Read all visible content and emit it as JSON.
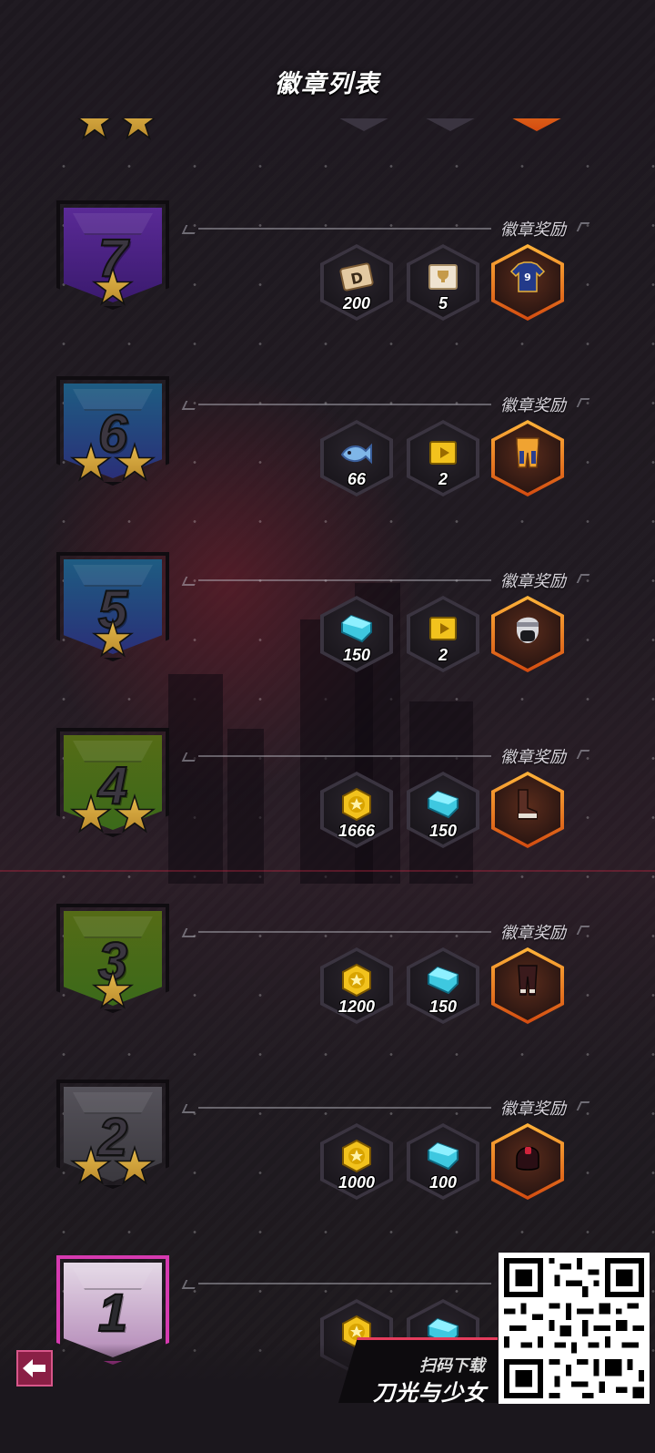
{
  "header": {
    "title": "徽章列表"
  },
  "reward_label": "徽章奖励",
  "badges": [
    {
      "level": "7",
      "stars": 1,
      "color": "#5a2a96",
      "color2": "#3a1a6e",
      "rewards": [
        {
          "icon": "ticket-d-icon",
          "qty": "200"
        },
        {
          "icon": "trophy-ticket-icon",
          "qty": "5"
        },
        {
          "icon": "jersey-icon",
          "qty": ""
        }
      ]
    },
    {
      "level": "6",
      "stars": 2,
      "color": "#1e5c82",
      "color2": "#2a2f78",
      "rewards": [
        {
          "icon": "fish-icon",
          "qty": "66"
        },
        {
          "icon": "video-card-icon",
          "qty": "2"
        },
        {
          "icon": "shorts-icon",
          "qty": ""
        }
      ]
    },
    {
      "level": "5",
      "stars": 1,
      "color": "#1e5c82",
      "color2": "#2a2f78",
      "rewards": [
        {
          "icon": "diamond-icon",
          "qty": "150"
        },
        {
          "icon": "video-card-icon",
          "qty": "2"
        },
        {
          "icon": "ninja-head-icon",
          "qty": ""
        }
      ]
    },
    {
      "level": "4",
      "stars": 2,
      "color": "#556b16",
      "color2": "#3b6a1a",
      "rewards": [
        {
          "icon": "gold-coin-icon",
          "qty": "1666"
        },
        {
          "icon": "diamond-icon",
          "qty": "150"
        },
        {
          "icon": "boots-icon",
          "qty": ""
        }
      ]
    },
    {
      "level": "3",
      "stars": 1,
      "color": "#556b16",
      "color2": "#3b6a1a",
      "rewards": [
        {
          "icon": "gold-coin-icon",
          "qty": "1200"
        },
        {
          "icon": "diamond-icon",
          "qty": "150"
        },
        {
          "icon": "leggings-icon",
          "qty": ""
        }
      ]
    },
    {
      "level": "2",
      "stars": 2,
      "color": "#55525a",
      "color2": "#3a383e",
      "rewards": [
        {
          "icon": "gold-coin-icon",
          "qty": "1000"
        },
        {
          "icon": "diamond-icon",
          "qty": "100"
        },
        {
          "icon": "hood-icon",
          "qty": ""
        }
      ]
    },
    {
      "level": "1",
      "stars": 0,
      "color": "#e4d8e6",
      "color2": "#b48ab8",
      "rewards": []
    }
  ],
  "promo": {
    "scan_text": "扫码下载",
    "game_name": "刀光与少女"
  }
}
